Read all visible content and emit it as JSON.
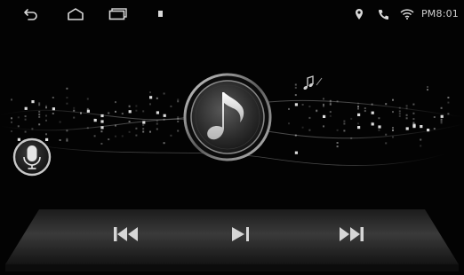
{
  "status_bar": {
    "nav_icons": [
      "back-icon",
      "home-icon",
      "recent-apps-icon",
      "notification-dot-icon"
    ],
    "indicator_icons": [
      "location-pin-icon",
      "phone-icon",
      "wifi-icon"
    ],
    "clock": "PM8:01"
  },
  "player": {
    "art_icon": "music-note-icon",
    "mic_icon": "microphone-icon",
    "controls": [
      "previous-track-icon",
      "play-pause-icon",
      "next-track-icon"
    ]
  },
  "colors": {
    "background": "#030303",
    "icon": "#d9d9d9",
    "visualizer_dot": "#e8e8e8"
  }
}
